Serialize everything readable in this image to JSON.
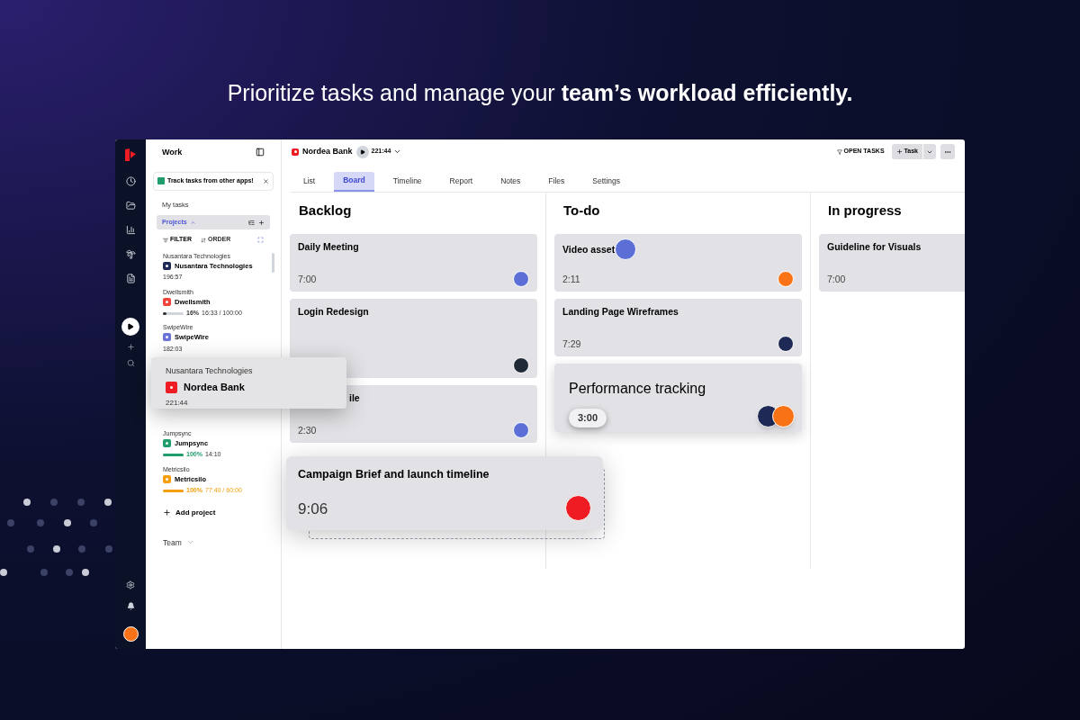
{
  "headline": "Prioritize tasks and manage your **team’s workload efficiently.**",
  "sidebar": {
    "title": "Work",
    "banner": "Track tasks from other apps!",
    "my_tasks": "My tasks",
    "projects_label": "Projects",
    "filter": "FILTER",
    "order": "ORDER",
    "projects": [
      {
        "client": "Nusantara Technologies",
        "name": "Nusantara Technologies",
        "color": "#1e2a55",
        "time": "196:57"
      },
      {
        "client": "Dwellsmith",
        "name": "Dwellsmith",
        "color": "#f0443a",
        "level": 0.16,
        "percent": "16%",
        "time": "16:33 / 100:00"
      },
      {
        "client": "SwipeWire",
        "name": "SwipeWire",
        "color": "#6b73d8",
        "time": "182:03"
      },
      {
        "client": "Jumpsync",
        "name": "Jumpsync",
        "color": "#1f9d6b",
        "level": 1,
        "percent": "100%",
        "time": "14:10"
      },
      {
        "client": "Metricsilo",
        "name": "Metricsilo",
        "color": "#f59e0b",
        "level": 1,
        "percent": "100%",
        "time": "77:40 / 60:00"
      }
    ],
    "add_project": "Add project",
    "team": "Team"
  },
  "dragged_project": {
    "client": "Nusantara Technologies",
    "name": "Nordea Bank",
    "color": "#ef1c24",
    "time": "221:44"
  },
  "header": {
    "project": "Nordea Bank",
    "time": "221:44",
    "open_tasks": "OPEN TASKS",
    "new_task": "Task"
  },
  "tabs": [
    {
      "label": "List",
      "selected": false
    },
    {
      "label": "Board",
      "selected": true
    },
    {
      "label": "Timeline",
      "selected": false
    },
    {
      "label": "Report",
      "selected": false
    },
    {
      "label": "Notes",
      "selected": false
    },
    {
      "label": "Files",
      "selected": false
    },
    {
      "label": "Settings",
      "selected": false
    }
  ],
  "columns": [
    {
      "title": "Backlog",
      "cards": [
        {
          "kind": "short",
          "title": "Daily Meeting",
          "time": "7:00",
          "avatars": [
            {
              "color": "#5b6fd6"
            }
          ]
        },
        {
          "kind": "tall",
          "title": "Login Redesign",
          "avatars": [
            {
              "color": "#1f2937"
            }
          ]
        },
        {
          "kind": "covered",
          "title": "ile",
          "time": "2:30",
          "avatars": [
            {
              "color": "#5b6fd6"
            }
          ]
        }
      ]
    },
    {
      "title": "To-do",
      "cards": [
        {
          "kind": "short",
          "title": "Video asset",
          "time": "2:11",
          "avatars": [
            {
              "color": "#f97316"
            }
          ],
          "floating_avatar": {
            "color": "#5b6fd6"
          }
        },
        {
          "kind": "short",
          "title": "Landing Page Wireframes",
          "time": "7:29",
          "avatars": [
            {
              "color": "#1e2a55"
            }
          ]
        },
        {
          "kind": "lifted",
          "title": "Performance tracking",
          "time": "3:00",
          "avatars": [
            {
              "color": "#1e2a55"
            },
            {
              "color": "#f97316"
            }
          ]
        }
      ]
    },
    {
      "title": "In progress",
      "cards": [
        {
          "kind": "short",
          "title": "Guideline for Visuals",
          "time": "7:00"
        }
      ]
    }
  ],
  "dragged_card": {
    "title": "Campaign Brief and launch timeline",
    "time": "9:06",
    "avatars": [
      {
        "color": "#ef1c24"
      }
    ]
  }
}
